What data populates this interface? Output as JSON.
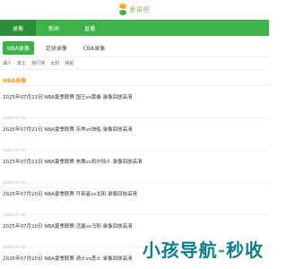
{
  "logo": {
    "text": "爱录吧"
  },
  "nav": {
    "items": [
      "录像",
      "新闻",
      "直播"
    ]
  },
  "subtabs": [
    "NBA录像",
    "足球录像",
    "CBA录像"
  ],
  "tags": [
    "湖人",
    "勇士",
    "独行侠",
    "太阳",
    "快船"
  ],
  "section": {
    "title": "NBA录像"
  },
  "items": [
    {
      "title": "2025年07月21日 NBA夏季联赛 国王vs黄蜂 录像回放高清",
      "date": "2025-07-21"
    },
    {
      "title": "2025年07月21日 NBA夏季联赛 灰熊vs快船 录像回放高清",
      "date": "2025-07-21"
    },
    {
      "title": "2025年07月21日 NBA夏季联赛 老鹰vs凯尔特人 录像回放高清",
      "date": "2025-07-21"
    },
    {
      "title": "2025年07月20日 NBA夏季联赛 开拓者vs太阳 录像回放高清",
      "date": "2025-07-20"
    },
    {
      "title": "2025年07月20日 NBA夏季联赛 活塞vs马刺 录像回放高清",
      "date": "2025-07-20"
    },
    {
      "title": "2025年07月20日 NBA夏季联赛 骑士vs勇士 录像回放高清",
      "date": "2025-07-20"
    }
  ],
  "watermark": {
    "part1": "小孩导航",
    "dash": "-",
    "part2": "秒收"
  }
}
